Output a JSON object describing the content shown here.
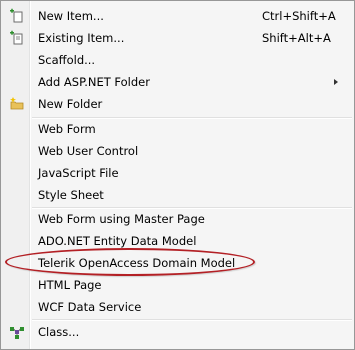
{
  "menu": {
    "items": [
      {
        "label": "New Item...",
        "shortcut": "Ctrl+Shift+A",
        "icon": "new-item-icon"
      },
      {
        "label": "Existing Item...",
        "shortcut": "Shift+Alt+A",
        "icon": "existing-item-icon"
      },
      {
        "label": "Scaffold...",
        "shortcut": ""
      },
      {
        "label": "Add ASP.NET Folder",
        "shortcut": "",
        "submenu": true
      },
      {
        "label": "New Folder",
        "shortcut": "",
        "icon": "new-folder-icon"
      },
      {
        "label": "Web Form"
      },
      {
        "label": "Web User Control"
      },
      {
        "label": "JavaScript File"
      },
      {
        "label": "Style Sheet"
      },
      {
        "label": "Web Form using Master Page"
      },
      {
        "label": "ADO.NET Entity Data Model"
      },
      {
        "label": "Telerik OpenAccess Domain Model",
        "highlighted": true
      },
      {
        "label": "HTML Page"
      },
      {
        "label": "WCF Data Service"
      },
      {
        "label": "Class...",
        "icon": "class-icon"
      }
    ]
  },
  "colors": {
    "annotation_ellipse": "#b32025",
    "menu_background": "#f5f5f5",
    "menu_border": "#979797"
  }
}
